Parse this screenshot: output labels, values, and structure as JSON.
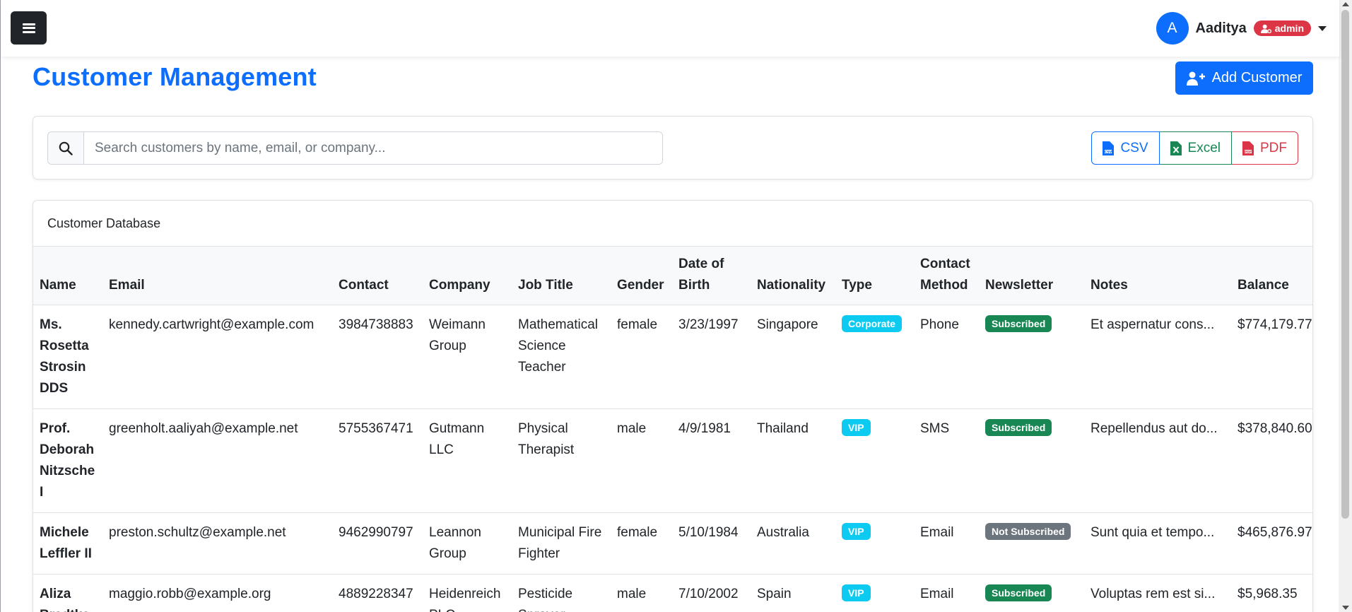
{
  "navbar": {
    "menu_icon": "hamburger-icon",
    "user": {
      "avatar_initial": "A",
      "name": "Aaditya",
      "role": "admin",
      "role_icon": "user-gear-icon"
    }
  },
  "page": {
    "title": "Customer Management",
    "add_button_label": "Add Customer",
    "add_button_icon": "user-plus-icon"
  },
  "search": {
    "placeholder": "Search customers by name, email, or company...",
    "value": "",
    "icon": "search-icon"
  },
  "export": {
    "csv_label": "CSV",
    "excel_label": "Excel",
    "pdf_label": "PDF"
  },
  "table": {
    "card_title": "Customer Database",
    "headers": {
      "name": "Name",
      "email": "Email",
      "contact": "Contact",
      "company": "Company",
      "job_title": "Job Title",
      "gender": "Gender",
      "dob": "Date of Birth",
      "nationality": "Nationality",
      "type": "Type",
      "contact_method": "Contact Method",
      "newsletter": "Newsletter",
      "notes": "Notes",
      "balance": "Balance"
    },
    "rows": [
      {
        "name": "Ms. Rosetta Strosin DDS",
        "email": "kennedy.cartwright@example.com",
        "contact": "3984738883",
        "company": "Weimann Group",
        "job_title": "Mathematical Science Teacher",
        "gender": "female",
        "dob": "3/23/1997",
        "nationality": "Singapore",
        "type": "Corporate",
        "contact_method": "Phone",
        "newsletter": "Subscribed",
        "notes": "Et aspernatur cons...",
        "balance": "$774,179.77"
      },
      {
        "name": "Prof. Deborah Nitzsche I",
        "email": "greenholt.aaliyah@example.net",
        "contact": "5755367471",
        "company": "Gutmann LLC",
        "job_title": "Physical Therapist",
        "gender": "male",
        "dob": "4/9/1981",
        "nationality": "Thailand",
        "type": "VIP",
        "contact_method": "SMS",
        "newsletter": "Subscribed",
        "notes": "Repellendus aut do...",
        "balance": "$378,840.60"
      },
      {
        "name": "Michele Leffler II",
        "email": "preston.schultz@example.net",
        "contact": "9462990797",
        "company": "Leannon Group",
        "job_title": "Municipal Fire Fighter",
        "gender": "female",
        "dob": "5/10/1984",
        "nationality": "Australia",
        "type": "VIP",
        "contact_method": "Email",
        "newsletter": "Not Subscribed",
        "notes": "Sunt quia et tempo...",
        "balance": "$465,876.97"
      },
      {
        "name": "Aliza Bradtke",
        "email": "maggio.robb@example.org",
        "contact": "4889228347",
        "company": "Heidenreich PLC",
        "job_title": "Pesticide Sprayer",
        "gender": "male",
        "dob": "7/10/2002",
        "nationality": "Spain",
        "type": "VIP",
        "contact_method": "Email",
        "newsletter": "Subscribed",
        "notes": "Voluptas rem est si...",
        "balance": "$5,968.35"
      }
    ]
  },
  "colors": {
    "primary": "#0d6efd",
    "success": "#198754",
    "danger": "#dc3545",
    "info": "#0dcaf0",
    "secondary": "#6c757d"
  }
}
